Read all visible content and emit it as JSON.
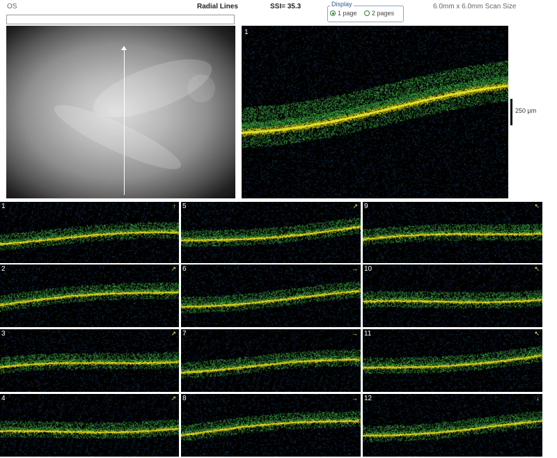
{
  "header": {
    "eye": "OS",
    "scan_type": "Radial Lines",
    "ssi": "SSI= 35.3",
    "scan_size": "6.0mm x 6.0mm Scan Size"
  },
  "display": {
    "legend": "Display",
    "options": [
      {
        "label": "1 page",
        "selected": true
      },
      {
        "label": "2 pages",
        "selected": false
      }
    ]
  },
  "main_scan": {
    "number": "1",
    "scale_label": "250 µm"
  },
  "thumbnails": [
    {
      "number": "1",
      "arrow": "↑"
    },
    {
      "number": "2",
      "arrow": "↗"
    },
    {
      "number": "3",
      "arrow": "↗"
    },
    {
      "number": "4",
      "arrow": "↗"
    },
    {
      "number": "5",
      "arrow": "↗"
    },
    {
      "number": "6",
      "arrow": "→"
    },
    {
      "number": "7",
      "arrow": "→"
    },
    {
      "number": "8",
      "arrow": "→"
    },
    {
      "number": "9",
      "arrow": "↖"
    },
    {
      "number": "10",
      "arrow": "↖"
    },
    {
      "number": "11",
      "arrow": "↖"
    },
    {
      "number": "12",
      "arrow": "↓"
    }
  ],
  "colors": {
    "oct_background": "#000000",
    "retina_green": "#4fd24a",
    "rpe_yellow": "#f2f21e",
    "noise_blue": "#1e5bb0"
  }
}
